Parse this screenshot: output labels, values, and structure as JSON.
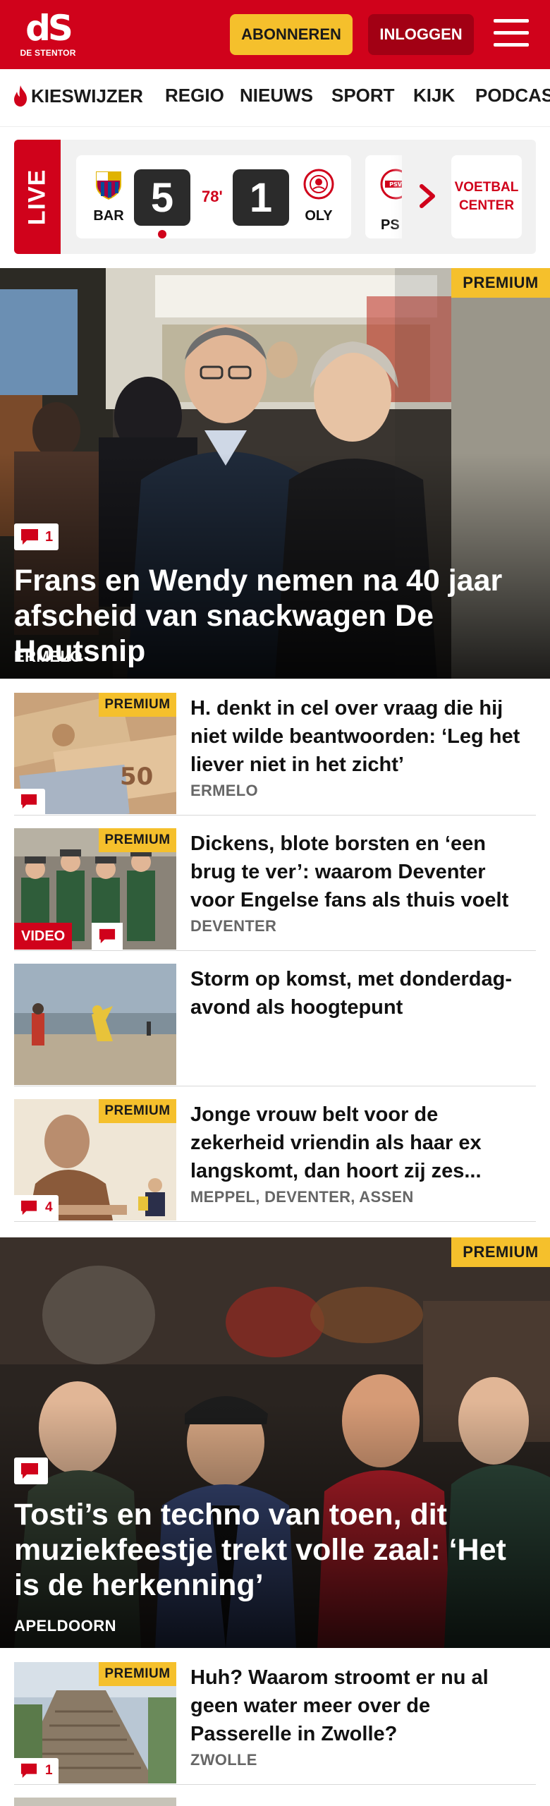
{
  "header": {
    "logo_mark": "dS",
    "logo_sub": "DE STENTOR",
    "subscribe_label": "ABONNEREN",
    "login_label": "INLOGGEN",
    "brand_color": "#d0021b",
    "accent_color": "#f5c02c"
  },
  "nav": {
    "items": [
      "KIESWIJZER",
      "REGIO",
      "NIEUWS",
      "SPORT",
      "KIJK",
      "PODCAS"
    ]
  },
  "live": {
    "label": "LIVE",
    "match": {
      "home": "BAR",
      "away": "OLY",
      "home_score": "5",
      "away_score": "1",
      "minute": "78'"
    },
    "next_team": "PS",
    "voetbal_center": "VOETBAL CENTER"
  },
  "hero1": {
    "premium": "PREMIUM",
    "comments": "1",
    "headline": "Frans en Wendy nemen na 40 jaar afscheid van snackwagen De Houtsnip",
    "location": "ERMELO"
  },
  "articles1": [
    {
      "premium": "PREMIUM",
      "title": "H. denkt in cel over vraag die hij niet wilde beantwoorden: ‘Leg het liever niet in het zicht’",
      "location": "ERMELO"
    },
    {
      "premium": "PREMIUM",
      "video": "VIDEO",
      "title": "Dickens, blote borsten en ‘een brug te ver’: waarom Deventer voor Engelse fans als thuis voelt",
      "location": "DEVENTER"
    },
    {
      "title": "Storm op komst, met donderdag­avond als hoogtepunt"
    },
    {
      "premium": "PREMIUM",
      "comments": "4",
      "title": "Jonge vrouw belt voor de zekerheid vriendin als haar ex langskomt, dan hoort zij zes...",
      "location": "MEPPEL, DEVENTER, ASSEN"
    }
  ],
  "hero2": {
    "premium": "PREMIUM",
    "headline": "Tosti’s en techno van toen, dit muziek­feestje trekt volle zaal: ‘Het is de herkenning’",
    "location": "APELDOORN"
  },
  "articles2": [
    {
      "premium": "PREMIUM",
      "comments": "1",
      "title": "Huh? Waarom stroomt er nu al geen water meer over de Passerelle in Zwolle?",
      "location": "ZWOLLE"
    }
  ]
}
